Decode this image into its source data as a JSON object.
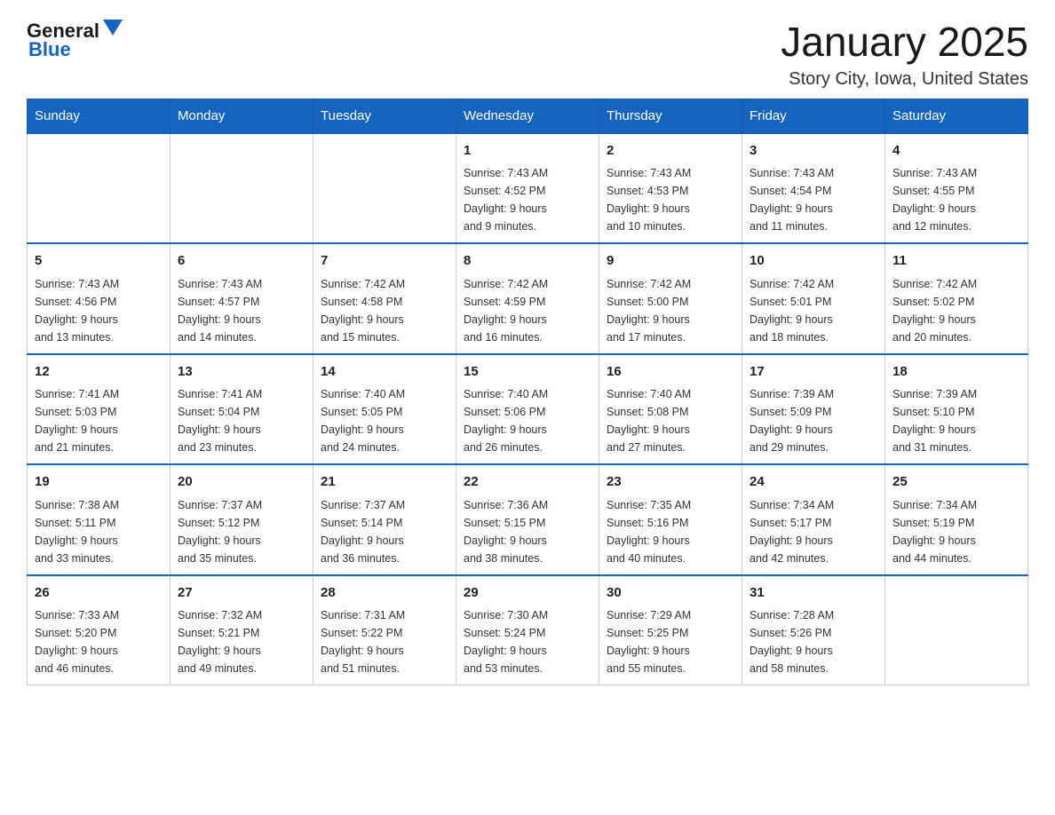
{
  "header": {
    "logo": {
      "text_general": "General",
      "text_blue": "Blue",
      "arrow": "▲"
    },
    "title": "January 2025",
    "subtitle": "Story City, Iowa, United States"
  },
  "weekdays": [
    "Sunday",
    "Monday",
    "Tuesday",
    "Wednesday",
    "Thursday",
    "Friday",
    "Saturday"
  ],
  "weeks": [
    [
      {
        "day": "",
        "info": ""
      },
      {
        "day": "",
        "info": ""
      },
      {
        "day": "",
        "info": ""
      },
      {
        "day": "1",
        "info": "Sunrise: 7:43 AM\nSunset: 4:52 PM\nDaylight: 9 hours\nand 9 minutes."
      },
      {
        "day": "2",
        "info": "Sunrise: 7:43 AM\nSunset: 4:53 PM\nDaylight: 9 hours\nand 10 minutes."
      },
      {
        "day": "3",
        "info": "Sunrise: 7:43 AM\nSunset: 4:54 PM\nDaylight: 9 hours\nand 11 minutes."
      },
      {
        "day": "4",
        "info": "Sunrise: 7:43 AM\nSunset: 4:55 PM\nDaylight: 9 hours\nand 12 minutes."
      }
    ],
    [
      {
        "day": "5",
        "info": "Sunrise: 7:43 AM\nSunset: 4:56 PM\nDaylight: 9 hours\nand 13 minutes."
      },
      {
        "day": "6",
        "info": "Sunrise: 7:43 AM\nSunset: 4:57 PM\nDaylight: 9 hours\nand 14 minutes."
      },
      {
        "day": "7",
        "info": "Sunrise: 7:42 AM\nSunset: 4:58 PM\nDaylight: 9 hours\nand 15 minutes."
      },
      {
        "day": "8",
        "info": "Sunrise: 7:42 AM\nSunset: 4:59 PM\nDaylight: 9 hours\nand 16 minutes."
      },
      {
        "day": "9",
        "info": "Sunrise: 7:42 AM\nSunset: 5:00 PM\nDaylight: 9 hours\nand 17 minutes."
      },
      {
        "day": "10",
        "info": "Sunrise: 7:42 AM\nSunset: 5:01 PM\nDaylight: 9 hours\nand 18 minutes."
      },
      {
        "day": "11",
        "info": "Sunrise: 7:42 AM\nSunset: 5:02 PM\nDaylight: 9 hours\nand 20 minutes."
      }
    ],
    [
      {
        "day": "12",
        "info": "Sunrise: 7:41 AM\nSunset: 5:03 PM\nDaylight: 9 hours\nand 21 minutes."
      },
      {
        "day": "13",
        "info": "Sunrise: 7:41 AM\nSunset: 5:04 PM\nDaylight: 9 hours\nand 23 minutes."
      },
      {
        "day": "14",
        "info": "Sunrise: 7:40 AM\nSunset: 5:05 PM\nDaylight: 9 hours\nand 24 minutes."
      },
      {
        "day": "15",
        "info": "Sunrise: 7:40 AM\nSunset: 5:06 PM\nDaylight: 9 hours\nand 26 minutes."
      },
      {
        "day": "16",
        "info": "Sunrise: 7:40 AM\nSunset: 5:08 PM\nDaylight: 9 hours\nand 27 minutes."
      },
      {
        "day": "17",
        "info": "Sunrise: 7:39 AM\nSunset: 5:09 PM\nDaylight: 9 hours\nand 29 minutes."
      },
      {
        "day": "18",
        "info": "Sunrise: 7:39 AM\nSunset: 5:10 PM\nDaylight: 9 hours\nand 31 minutes."
      }
    ],
    [
      {
        "day": "19",
        "info": "Sunrise: 7:38 AM\nSunset: 5:11 PM\nDaylight: 9 hours\nand 33 minutes."
      },
      {
        "day": "20",
        "info": "Sunrise: 7:37 AM\nSunset: 5:12 PM\nDaylight: 9 hours\nand 35 minutes."
      },
      {
        "day": "21",
        "info": "Sunrise: 7:37 AM\nSunset: 5:14 PM\nDaylight: 9 hours\nand 36 minutes."
      },
      {
        "day": "22",
        "info": "Sunrise: 7:36 AM\nSunset: 5:15 PM\nDaylight: 9 hours\nand 38 minutes."
      },
      {
        "day": "23",
        "info": "Sunrise: 7:35 AM\nSunset: 5:16 PM\nDaylight: 9 hours\nand 40 minutes."
      },
      {
        "day": "24",
        "info": "Sunrise: 7:34 AM\nSunset: 5:17 PM\nDaylight: 9 hours\nand 42 minutes."
      },
      {
        "day": "25",
        "info": "Sunrise: 7:34 AM\nSunset: 5:19 PM\nDaylight: 9 hours\nand 44 minutes."
      }
    ],
    [
      {
        "day": "26",
        "info": "Sunrise: 7:33 AM\nSunset: 5:20 PM\nDaylight: 9 hours\nand 46 minutes."
      },
      {
        "day": "27",
        "info": "Sunrise: 7:32 AM\nSunset: 5:21 PM\nDaylight: 9 hours\nand 49 minutes."
      },
      {
        "day": "28",
        "info": "Sunrise: 7:31 AM\nSunset: 5:22 PM\nDaylight: 9 hours\nand 51 minutes."
      },
      {
        "day": "29",
        "info": "Sunrise: 7:30 AM\nSunset: 5:24 PM\nDaylight: 9 hours\nand 53 minutes."
      },
      {
        "day": "30",
        "info": "Sunrise: 7:29 AM\nSunset: 5:25 PM\nDaylight: 9 hours\nand 55 minutes."
      },
      {
        "day": "31",
        "info": "Sunrise: 7:28 AM\nSunset: 5:26 PM\nDaylight: 9 hours\nand 58 minutes."
      },
      {
        "day": "",
        "info": ""
      }
    ]
  ]
}
